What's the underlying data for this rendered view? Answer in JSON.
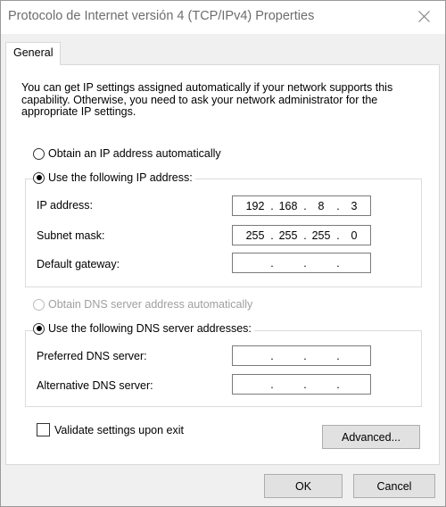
{
  "window": {
    "title": "Protocolo de Internet versión 4 (TCP/IPv4) Properties",
    "close_icon": "close-icon"
  },
  "tabs": [
    {
      "label": "General"
    }
  ],
  "intro_text": "You can get IP settings assigned automatically if your network supports this capability. Otherwise, you need to ask your network administrator for the appropriate IP settings.",
  "ip_section": {
    "obtain_auto_label": "Obtain an IP address automatically",
    "use_following_label": "Use the following IP address:",
    "selected": "use_following",
    "ip_address": {
      "label": "IP address:",
      "octets": [
        "192",
        "168",
        "8",
        "3"
      ]
    },
    "subnet_mask": {
      "label": "Subnet mask:",
      "octets": [
        "255",
        "255",
        "255",
        "0"
      ]
    },
    "default_gateway": {
      "label": "Default gateway:",
      "octets": [
        "",
        "",
        "",
        ""
      ]
    }
  },
  "dns_section": {
    "obtain_auto_label": "Obtain DNS server address automatically",
    "obtain_auto_disabled": true,
    "use_following_label": "Use the following DNS server addresses:",
    "selected": "use_following",
    "preferred": {
      "label": "Preferred DNS server:",
      "octets": [
        "",
        "",
        "",
        ""
      ]
    },
    "alternative": {
      "label": "Alternative DNS server:",
      "octets": [
        "",
        "",
        "",
        ""
      ]
    }
  },
  "validate_label": "Validate settings upon exit",
  "validate_checked": false,
  "buttons": {
    "advanced": "Advanced...",
    "ok": "OK",
    "cancel": "Cancel"
  },
  "ip_separator": "."
}
